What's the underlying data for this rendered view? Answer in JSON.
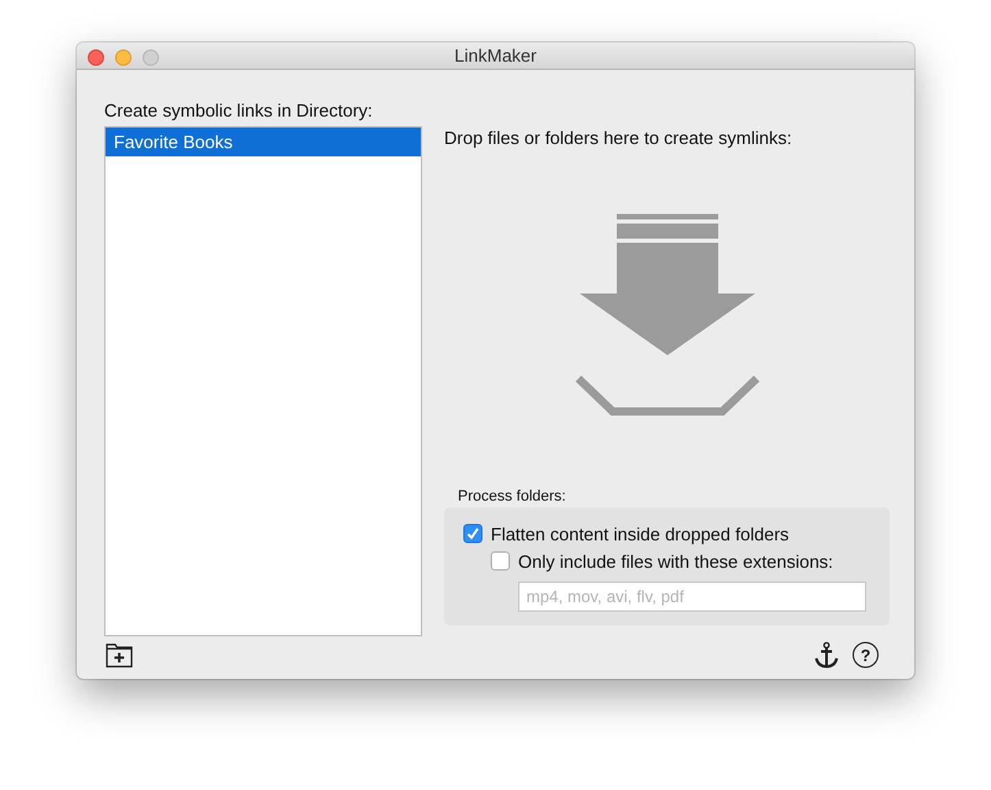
{
  "window": {
    "title": "LinkMaker"
  },
  "directories": {
    "label": "Create symbolic links in Directory:",
    "items": [
      {
        "label": "Favorite Books",
        "selected": true
      }
    ]
  },
  "drop_zone": {
    "label": "Drop files or folders here to create symlinks:"
  },
  "process_folders": {
    "label": "Process folders:",
    "options": [
      {
        "label": "Flatten content inside dropped folders",
        "checked": true,
        "children": [
          {
            "label": "Only include files with these extensions:",
            "checked": false
          }
        ]
      }
    ],
    "extensions": {
      "placeholder": "mp4, mov, avi, flv, pdf"
    }
  },
  "footer": {
    "help": "?"
  }
}
